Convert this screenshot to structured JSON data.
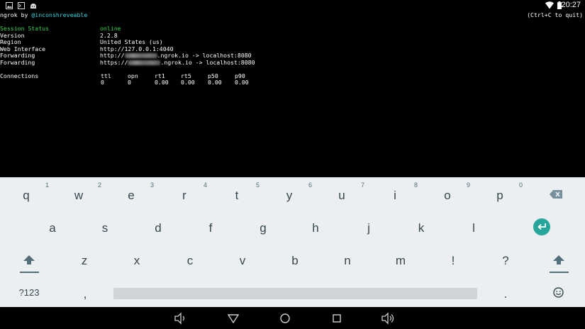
{
  "status_bar": {
    "time": "20:27",
    "icons": [
      "image-icon",
      "terminal-icon",
      "android-icon",
      "wifi-icon",
      "battery-icon"
    ]
  },
  "terminal": {
    "title_prefix": "ngrok by ",
    "title_handle": "@inconshreveable",
    "quit_hint": "(Ctrl+C to quit)",
    "session_label": "Session Status",
    "session_value": "online",
    "version_label": "Version",
    "version_value": "2.2.8",
    "region_label": "Region",
    "region_value": "United States (us)",
    "web_label": "Web Interface",
    "web_value": "http://127.0.0.1:4040",
    "fwd1_label": "Forwarding",
    "fwd1_prefix": "http://",
    "fwd1_suffix": ".ngrok.io -> localhost:8080",
    "fwd2_label": "Forwarding",
    "fwd2_prefix": "https://",
    "fwd2_suffix": ".ngrok.io -> localhost:8080",
    "connections_label": "Connections",
    "conn_headers": [
      "ttl",
      "opn",
      "rt1",
      "rt5",
      "p50",
      "p90"
    ],
    "conn_values": [
      "0",
      "0",
      "0.00",
      "0.00",
      "0.00",
      "0.00"
    ]
  },
  "keyboard": {
    "row1": [
      "q",
      "w",
      "e",
      "r",
      "t",
      "y",
      "u",
      "i",
      "o",
      "p"
    ],
    "row1_hints": [
      "1",
      "2",
      "3",
      "4",
      "5",
      "6",
      "7",
      "8",
      "9",
      "0"
    ],
    "row2": [
      "a",
      "s",
      "d",
      "f",
      "g",
      "h",
      "j",
      "k",
      "l"
    ],
    "row3": [
      "z",
      "x",
      "c",
      "v",
      "b",
      "n",
      "m",
      "!",
      "?"
    ],
    "symbols_label": "?123",
    "comma_label": ",",
    "period_label": "."
  },
  "colors": {
    "terminal_green": "#39d353",
    "terminal_cyan": "#2fd4e0",
    "keyboard_bg": "#eceff1",
    "enter_key": "#26a69a"
  }
}
